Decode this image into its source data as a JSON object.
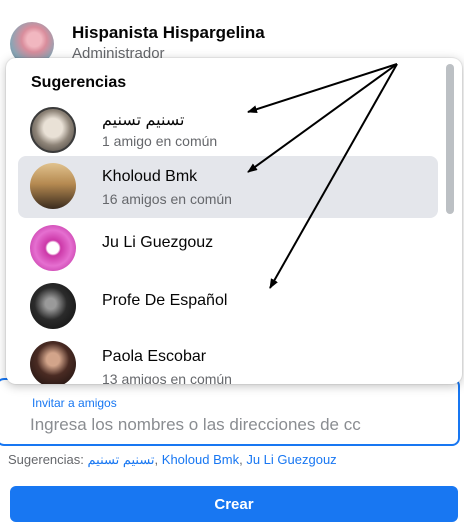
{
  "admin": {
    "name": "Hispanista Hispargelina",
    "role": "Administrador"
  },
  "suggestions_dropdown": {
    "title": "Sugerencias",
    "items": [
      {
        "name": "تسنيم تسنيم",
        "mutual": "1 amigo en común",
        "active": false
      },
      {
        "name": "Kholoud Bmk",
        "mutual": "16 amigos en común",
        "active": true
      },
      {
        "name": "Ju Li Guezgouz",
        "mutual": "",
        "active": false
      },
      {
        "name": "Profe De Español",
        "mutual": "",
        "active": false
      },
      {
        "name": "Paola Escobar",
        "mutual": "13 amigos en común",
        "active": false
      }
    ]
  },
  "invite": {
    "label": "Invitar a amigos",
    "placeholder": "Ingresa los nombres o las direcciones de cc"
  },
  "suggestions_line": {
    "prefix": "Sugerencias: ",
    "links": [
      "تسنيم تسنيم",
      "Kholoud Bmk",
      "Ju Li Guezgouz"
    ],
    "separator": ", "
  },
  "create_button": {
    "label": "Crear"
  },
  "colors": {
    "accent": "#1877f2",
    "active_row": "#e4e6eb",
    "secondary_text": "#65676b"
  }
}
